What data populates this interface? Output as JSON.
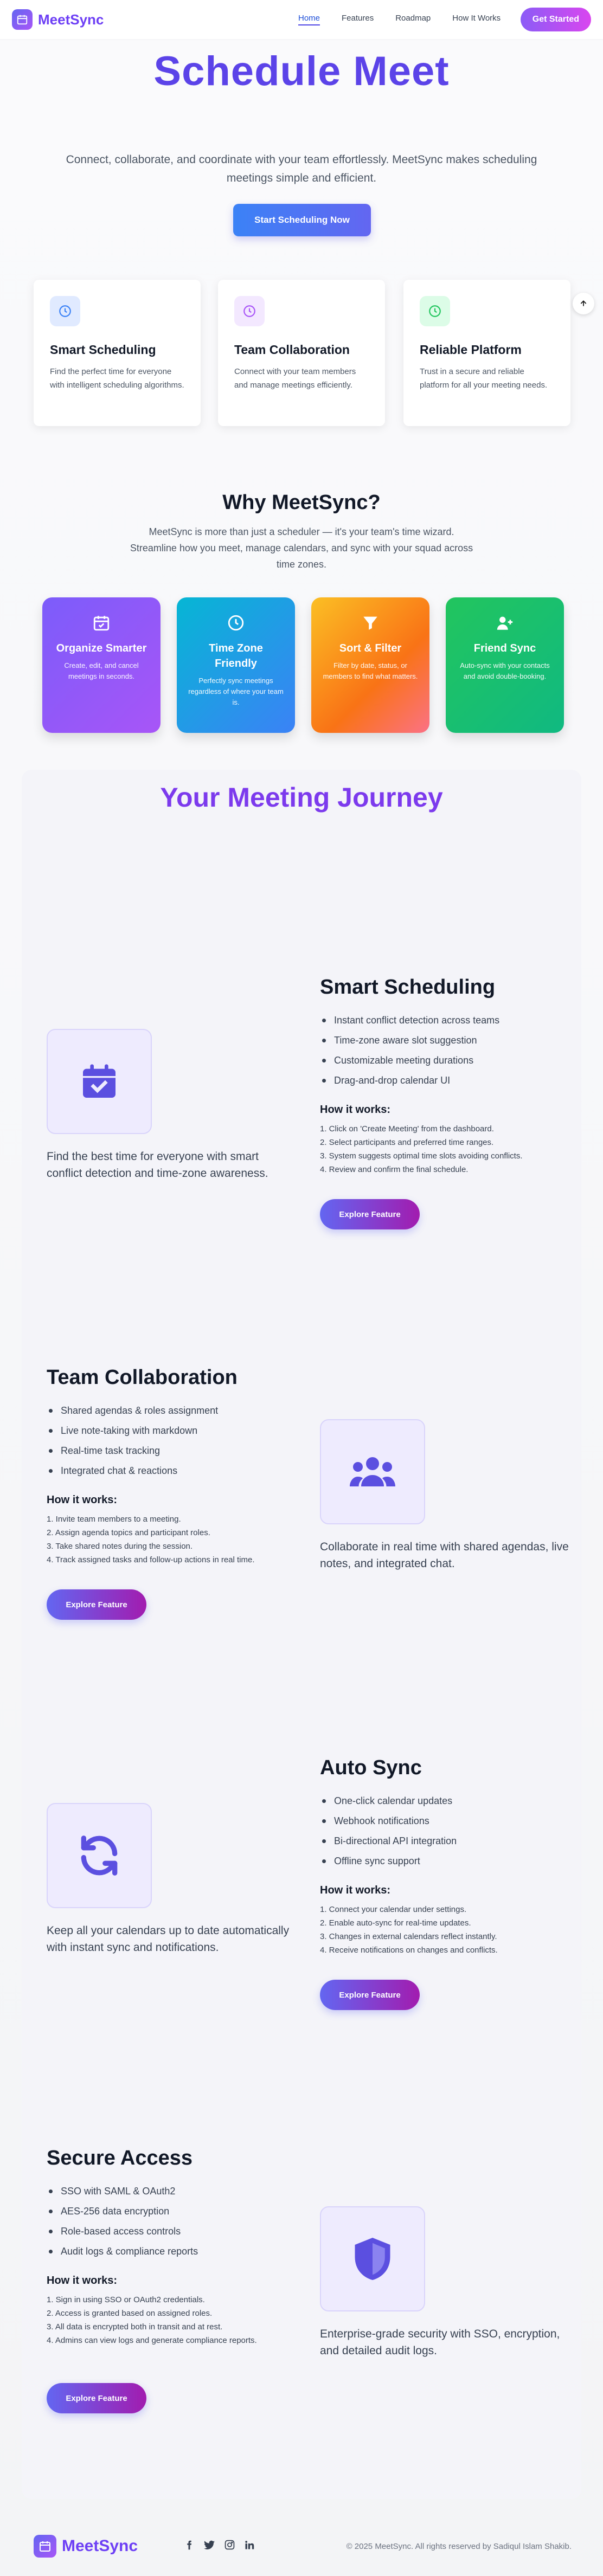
{
  "nav": {
    "brand": "MeetSync",
    "links": [
      "Home",
      "Features",
      "Roadmap",
      "How It Works"
    ],
    "cta": "Get Started"
  },
  "hero": {
    "title": "Schedule Meet",
    "subtitle": "Connect, collaborate, and coordinate with your team effortlessly. MeetSync makes scheduling meetings simple and efficient.",
    "button": "Start Scheduling Now"
  },
  "features": [
    {
      "title": "Smart Scheduling",
      "text": "Find the perfect time for everyone with intelligent scheduling algorithms.",
      "icon": "clock-icon"
    },
    {
      "title": "Team Collaboration",
      "text": "Connect with your team members and manage meetings efficiently.",
      "icon": "clock-icon"
    },
    {
      "title": "Reliable Platform",
      "text": "Trust in a secure and reliable platform for all your meeting needs.",
      "icon": "clock-icon"
    }
  ],
  "why": {
    "title": "Why MeetSync?",
    "subtitle": "MeetSync is more than just a scheduler — it's your team's time wizard. Streamline how you meet, manage calendars, and sync with your squad across time zones.",
    "cards": [
      {
        "title": "Organize Smarter",
        "text": "Create, edit, and cancel meetings in seconds.",
        "icon": "calendar-check-icon",
        "color": "#8b5cf6"
      },
      {
        "title": "Time Zone Friendly",
        "text": "Perfectly sync meetings regardless of where your team is.",
        "icon": "clock-globe-icon",
        "color": "#06b6d4"
      },
      {
        "title": "Sort & Filter",
        "text": "Filter by date, status, or members to find what matters.",
        "icon": "filter-icon",
        "color": "#fb923c"
      },
      {
        "title": "Friend Sync",
        "text": "Auto-sync with your contacts and avoid double-booking.",
        "icon": "user-plus-icon",
        "color": "#22c55e"
      }
    ]
  },
  "journey": {
    "title": "Your Meeting Journey",
    "how_label": "How it works:",
    "explore_label": "Explore Feature",
    "sections": [
      {
        "title": "Smart Scheduling",
        "caption": "Find the best time for everyone with smart conflict detection and time-zone awareness.",
        "bullets": [
          "Instant conflict detection across teams",
          "Time-zone aware slot suggestion",
          "Customizable meeting durations",
          "Drag-and-drop calendar UI"
        ],
        "steps": [
          "1. Click on 'Create Meeting' from the dashboard.",
          "2. Select participants and preferred time ranges.",
          "3. System suggests optimal time slots avoiding conflicts.",
          "4. Review and confirm the final schedule."
        ],
        "icon": "calendar-check-icon"
      },
      {
        "title": "Team Collaboration",
        "caption": "Collaborate in real time with shared agendas, live notes, and integrated chat.",
        "bullets": [
          "Shared agendas & roles assignment",
          "Live note-taking with markdown",
          "Real-time task tracking",
          "Integrated chat & reactions"
        ],
        "steps": [
          "1. Invite team members to a meeting.",
          "2. Assign agenda topics and participant roles.",
          "3. Take shared notes during the session.",
          "4. Track assigned tasks and follow-up actions in real time."
        ],
        "icon": "users-icon"
      },
      {
        "title": "Auto Sync",
        "caption": "Keep all your calendars up to date automatically with instant sync and notifications.",
        "bullets": [
          "One-click calendar updates",
          "Webhook notifications",
          "Bi-directional API integration",
          "Offline sync support"
        ],
        "steps": [
          "1. Connect your calendar under settings.",
          "2. Enable auto-sync for real-time updates.",
          "3. Changes in external calendars reflect instantly.",
          "4. Receive notifications on changes and conflicts."
        ],
        "icon": "sync-icon"
      },
      {
        "title": "Secure Access",
        "caption": "Enterprise-grade security with SSO, encryption, and detailed audit logs.",
        "bullets": [
          "SSO with SAML & OAuth2",
          "AES-256 data encryption",
          "Role-based access controls",
          "Audit logs & compliance reports"
        ],
        "steps": [
          "1. Sign in using SSO or OAuth2 credentials.",
          "2. Access is granted based on assigned roles.",
          "3. All data is encrypted both in transit and at rest.",
          "4. Admins can view logs and generate compliance reports."
        ],
        "icon": "shield-icon"
      }
    ]
  },
  "footer": {
    "brand": "MeetSync",
    "socials": [
      "facebook-icon",
      "twitter-icon",
      "instagram-icon",
      "linkedin-icon"
    ],
    "copyright": "© 2025 MeetSync. All rights reserved by Sadiqul Islam Shakib."
  }
}
